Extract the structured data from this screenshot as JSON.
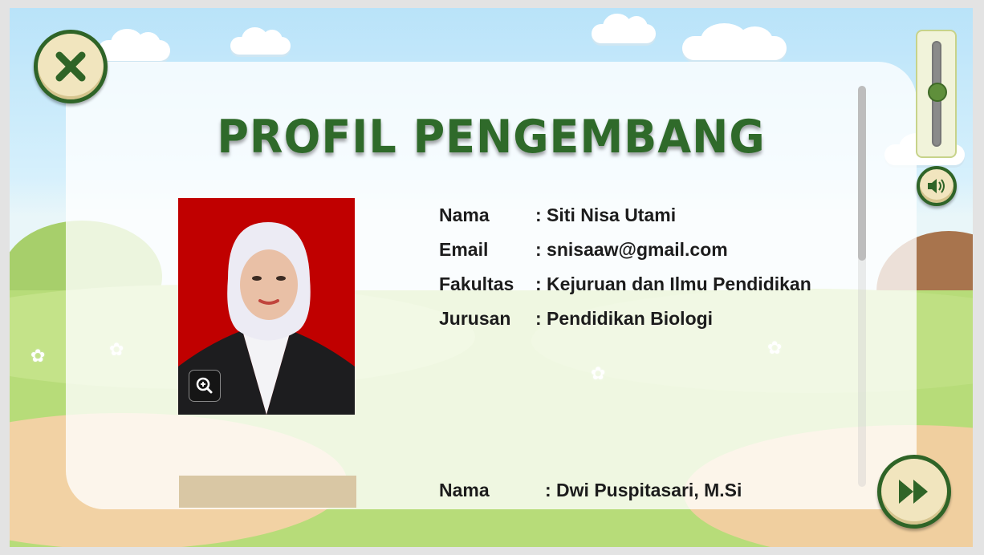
{
  "window": {
    "title": "PROFIL PENGEMBANG"
  },
  "controls": {
    "close_icon": "close-icon",
    "sound_icon": "speaker-icon",
    "next_icon": "fast-forward-icon",
    "zoom_icon": "zoom-in-icon",
    "volume_level": 0.52
  },
  "developers": [
    {
      "fields": [
        {
          "label": "Nama",
          "value": ": Siti Nisa Utami"
        },
        {
          "label": "Email",
          "value": ": snisaaw@gmail.com"
        },
        {
          "label": "Fakultas",
          "value": ": Kejuruan dan Ilmu Pendidikan"
        },
        {
          "label": "Jurusan",
          "value": ": Pendidikan Biologi"
        }
      ]
    },
    {
      "fields": [
        {
          "label": "Nama",
          "value": ": Dwi Puspitasari, M.Si"
        }
      ]
    }
  ],
  "colors": {
    "title": "#2f6a2a",
    "photo_bg": "#c00000",
    "button_ring": "#2f6427"
  }
}
